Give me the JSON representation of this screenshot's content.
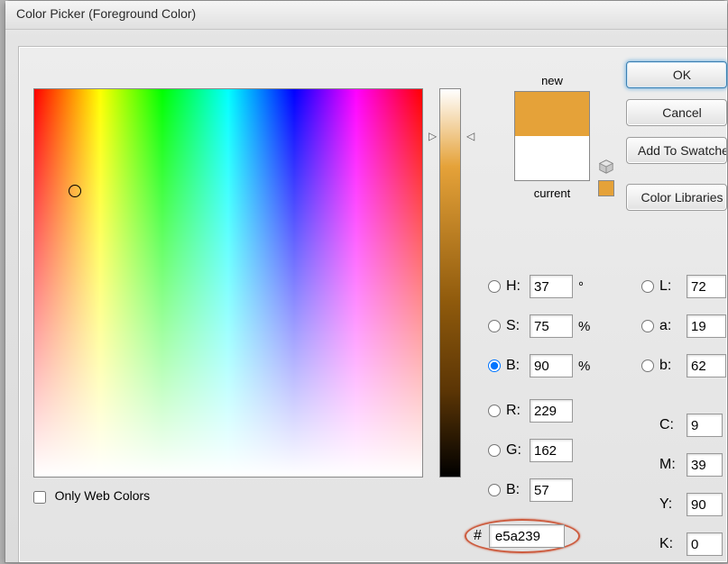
{
  "title": "Color Picker (Foreground Color)",
  "swatch": {
    "new_label": "new",
    "current_label": "current",
    "new_color": "#e5a239",
    "current_color": "#ffffff"
  },
  "buttons": {
    "ok": "OK",
    "cancel": "Cancel",
    "add_swatch": "Add To Swatches",
    "color_lib": "Color Libraries"
  },
  "only_web": {
    "label": "Only Web Colors",
    "checked": false
  },
  "hsb": {
    "h_label": "H:",
    "h_value": "37",
    "h_unit": "°",
    "s_label": "S:",
    "s_value": "75",
    "s_unit": "%",
    "b_label": "B:",
    "b_value": "90",
    "b_unit": "%"
  },
  "rgb": {
    "r_label": "R:",
    "r_value": "229",
    "g_label": "G:",
    "g_value": "162",
    "b_label": "B:",
    "b_value": "57"
  },
  "lab": {
    "l_label": "L:",
    "l_value": "72",
    "a_label": "a:",
    "a_value": "19",
    "b_label": "b:",
    "b_value": "62"
  },
  "cmyk": {
    "c_label": "C:",
    "c_value": "9",
    "m_label": "M:",
    "m_value": "39",
    "y_label": "Y:",
    "y_value": "90",
    "k_label": "K:",
    "k_value": "0"
  },
  "hex": {
    "hash": "#",
    "value": "e5a239"
  }
}
